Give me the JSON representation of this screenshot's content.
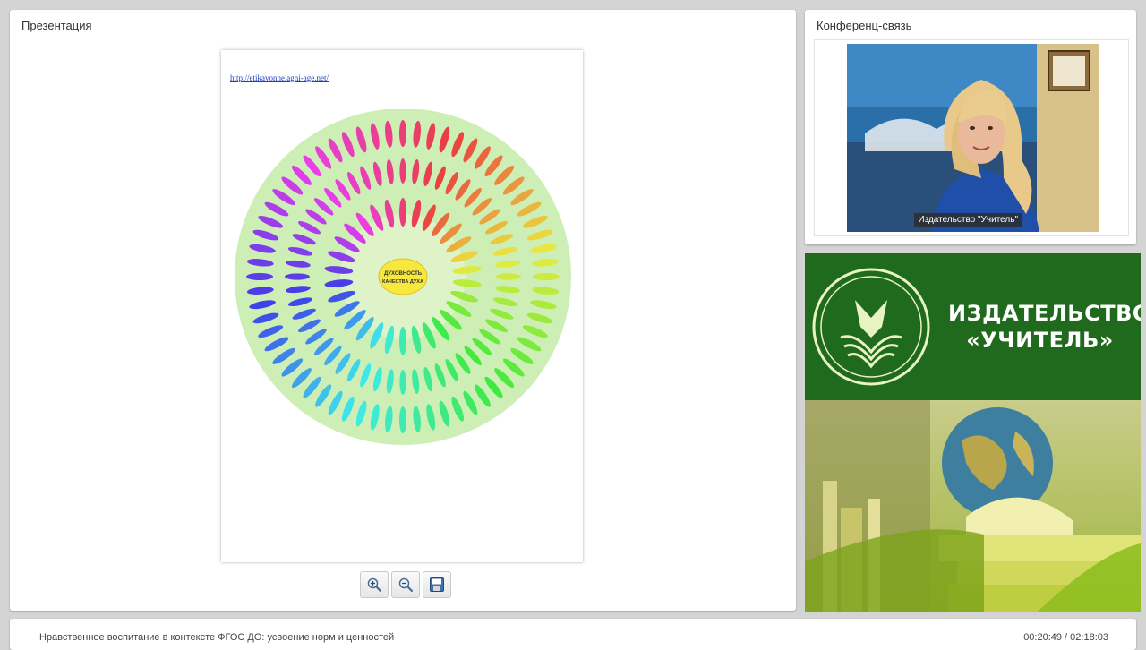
{
  "presentation": {
    "title": "Презентация",
    "slide": {
      "link": "http://etikavonne.agni-age.net/",
      "center_label_line1": "ДУХОВНОСТЬ",
      "center_label_line2": "КАЧЕСТВА ДУХА"
    },
    "toolbar": {
      "zoom_in": "zoom-in-icon",
      "zoom_out": "zoom-out-icon",
      "save": "save-icon"
    }
  },
  "conference": {
    "title": "Конференц-связь",
    "speaker_label": "Издательство \"Учитель\""
  },
  "brand": {
    "line1": "ИЗДАТЕЛЬСТВО",
    "line2": "«УЧИТЕЛЬ»",
    "colors": {
      "green": "#1f6a1c",
      "light": "#e8f3c4"
    }
  },
  "footer": {
    "title": "Нравственное воспитание в контексте ФГОС ДО: усвоение норм и ценностей",
    "time": "00:20:49 / 02:18:03"
  }
}
